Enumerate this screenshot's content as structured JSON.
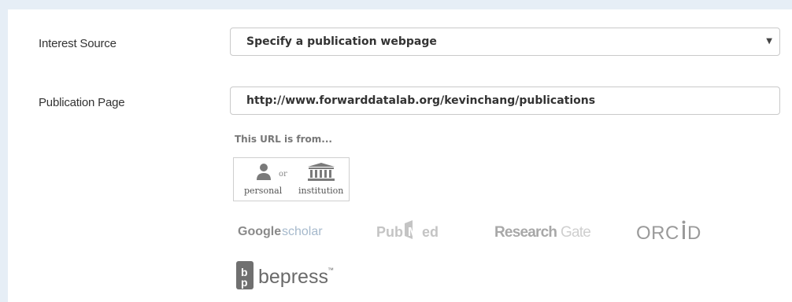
{
  "form": {
    "interest_source": {
      "label": "Interest Source",
      "selected_value": "Specify a publication webpage"
    },
    "publication_page": {
      "label": "Publication Page",
      "value": "http://www.forwarddatalab.org/kevinchang/publications"
    },
    "url_source": {
      "prompt": "This URL is from...",
      "personal_label": "personal",
      "or_label": "or",
      "institution_label": "institution"
    },
    "sources": [
      {
        "name": "Google scholar",
        "icon": "google-scholar-logo"
      },
      {
        "name": "PubMed",
        "icon": "pubmed-logo"
      },
      {
        "name": "ResearchGate",
        "icon": "researchgate-logo"
      },
      {
        "name": "ORCID",
        "icon": "orcid-logo"
      },
      {
        "name": "bepress",
        "icon": "bepress-logo"
      }
    ]
  },
  "colors": {
    "page_background": "#e6eef6",
    "panel_background": "#ffffff",
    "field_border": "#c9c9c9",
    "logo_gray": "#9a9a9a"
  }
}
